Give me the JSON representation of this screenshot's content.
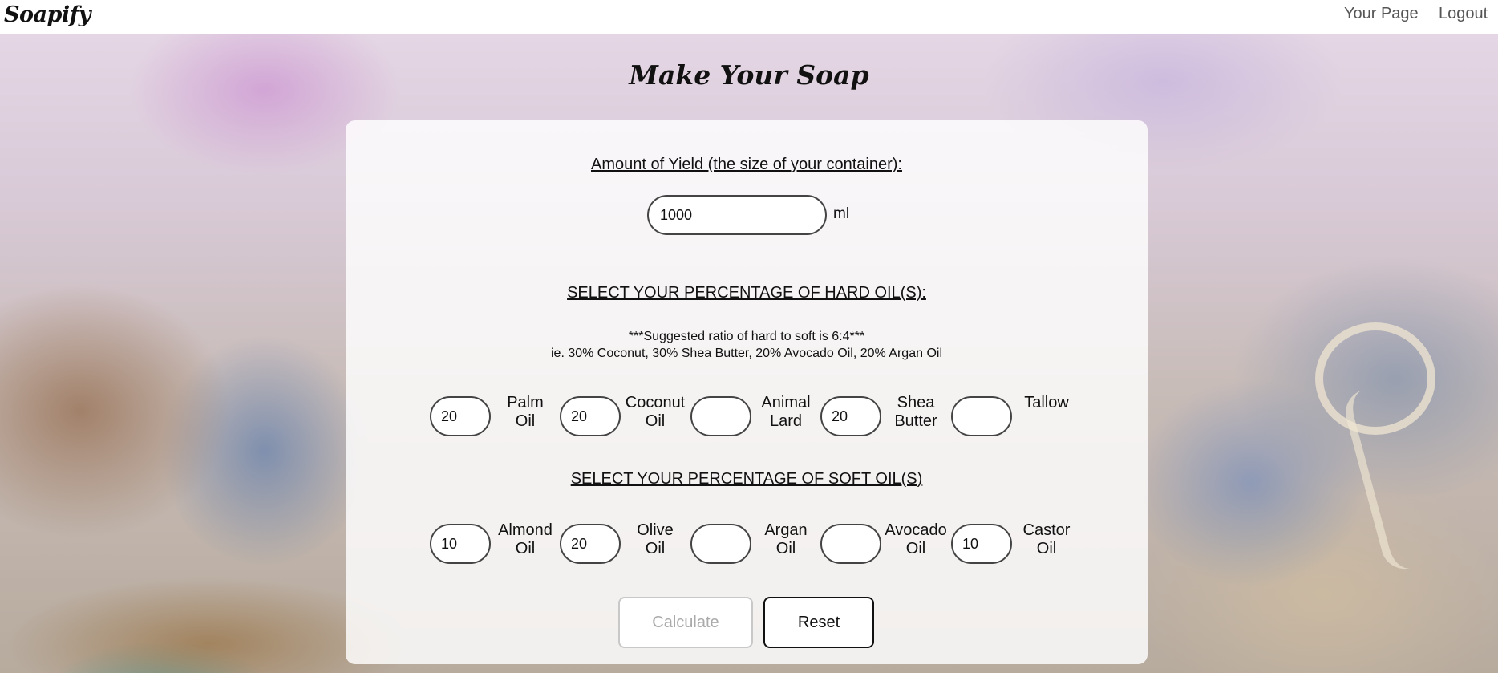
{
  "nav": {
    "brand": "Soapify",
    "links": [
      "Your Page",
      "Logout"
    ]
  },
  "page": {
    "title": "Make Your Soap"
  },
  "yield": {
    "heading": "Amount of Yield (the size of your container):",
    "value": "1000",
    "unit": "ml"
  },
  "hard": {
    "heading": "SELECT YOUR PERCENTAGE OF HARD OIL(S):",
    "suggestion_line1": "***Suggested ratio of hard to soft is 6:4***",
    "suggestion_line2": "ie. 30% Coconut, 30% Shea Butter, 20% Avocado Oil, 20% Argan Oil",
    "oils": [
      {
        "label1": "Palm",
        "label2": "Oil",
        "value": "20"
      },
      {
        "label1": "Coconut",
        "label2": "Oil",
        "value": "20"
      },
      {
        "label1": "Animal",
        "label2": "Lard",
        "value": ""
      },
      {
        "label1": "Shea",
        "label2": "Butter",
        "value": "20"
      },
      {
        "label1": "Tallow",
        "label2": "",
        "value": ""
      }
    ]
  },
  "soft": {
    "heading": "SELECT YOUR PERCENTAGE OF SOFT OIL(S)",
    "oils": [
      {
        "label1": "Almond",
        "label2": "Oil",
        "value": "10"
      },
      {
        "label1": "Olive",
        "label2": "Oil",
        "value": "20"
      },
      {
        "label1": "Argan",
        "label2": "Oil",
        "value": ""
      },
      {
        "label1": "Avocado",
        "label2": "Oil",
        "value": ""
      },
      {
        "label1": "Castor",
        "label2": "Oil",
        "value": "10"
      }
    ]
  },
  "actions": {
    "calculate_label": "Calculate",
    "reset_label": "Reset"
  },
  "colors": {
    "navbar_bg": "#ffffff",
    "nav_link": "#555555",
    "card_bg": "rgba(255,255,255,0.82)",
    "input_border": "#444444",
    "disabled_button_text": "#aaaaaa"
  }
}
